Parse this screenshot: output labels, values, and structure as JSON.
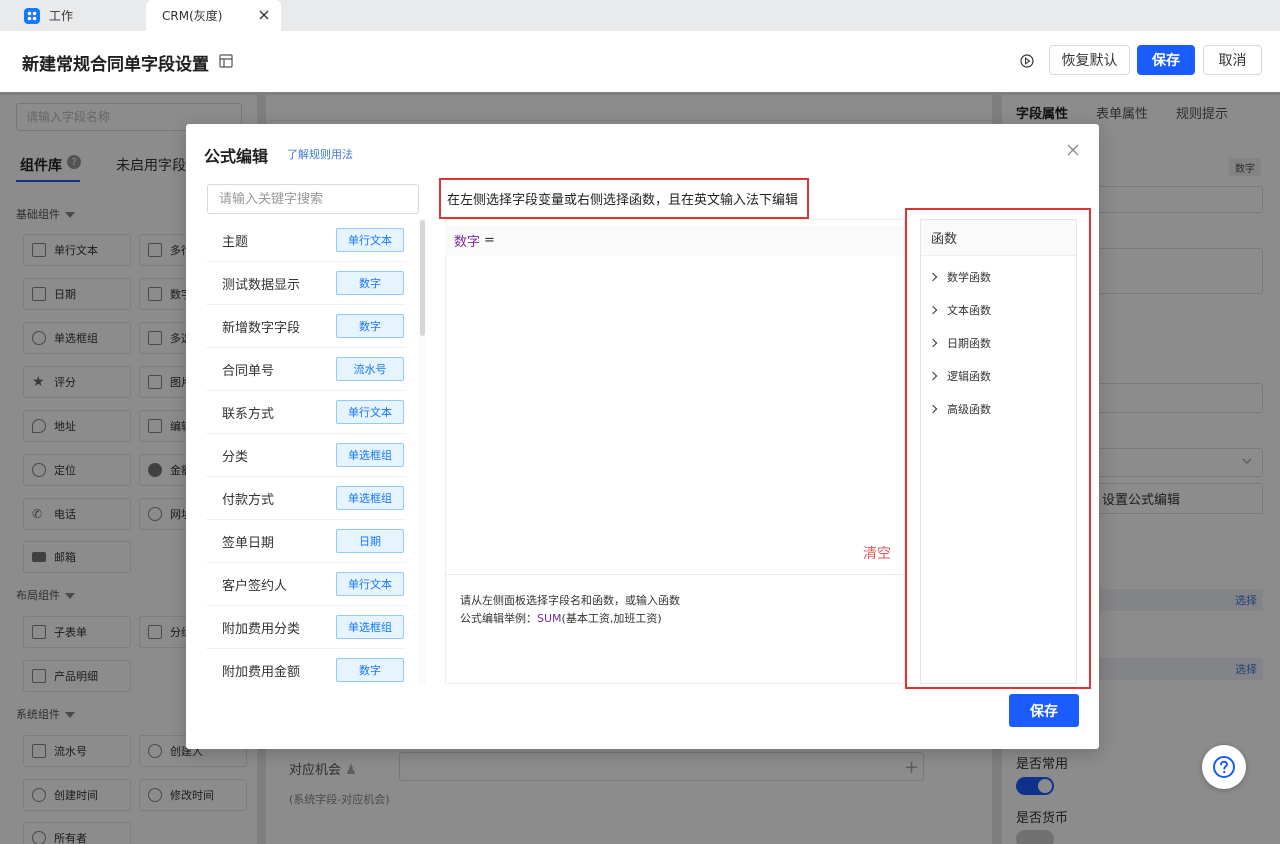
{
  "tabs": [
    {
      "label": "工作"
    },
    {
      "label": "CRM(灰度)"
    }
  ],
  "header": {
    "title": "新建常规合同单字段设置",
    "restore_label": "恢复默认",
    "save_label": "保存",
    "cancel_label": "取消"
  },
  "left": {
    "search_placeholder": "请输入字段名称",
    "tab_library": "组件库",
    "tab_unused": "未启用字段",
    "help_mark": "?",
    "sections": [
      {
        "title": "基础组件",
        "items": [
          "单行文本",
          "多行",
          "日期",
          "数字",
          "单选框组",
          "多选",
          "评分",
          "图片",
          "地址",
          "编辑",
          "定位",
          "金额",
          "电话",
          "网址",
          "邮箱"
        ]
      },
      {
        "title": "布局组件",
        "items": [
          "子表单",
          "分组",
          "产品明细"
        ]
      },
      {
        "title": "系统组件",
        "items": [
          "流水号",
          "创建人",
          "创建时间",
          "修改时间",
          "所有者"
        ]
      }
    ]
  },
  "center": {
    "opportunity_label": "对应机会",
    "opportunity_hint": "(系统字段-对应机会)"
  },
  "right": {
    "tab_field": "字段属性",
    "tab_form": "表单属性",
    "tab_rules": "规则提示",
    "type_badge": "数字",
    "set_formula_label": "设置公式编辑",
    "select_label_1": "选择",
    "select_label_2": "选择",
    "common_label": "是否常用",
    "currency_label": "是否货币",
    "common_on": true,
    "currency_on": false
  },
  "modal": {
    "title": "公式编辑",
    "help_link": "了解规则用法",
    "search_placeholder": "请输入关键字搜索",
    "hint": "在左侧选择字段变量或右侧选择函数，且在英文输入法下编辑",
    "fields": [
      {
        "name": "主题",
        "type": "单行文本"
      },
      {
        "name": "测试数据显示",
        "type": "数字"
      },
      {
        "name": "新增数字字段",
        "type": "数字"
      },
      {
        "name": "合同单号",
        "type": "流水号"
      },
      {
        "name": "联系方式",
        "type": "单行文本"
      },
      {
        "name": "分类",
        "type": "单选框组"
      },
      {
        "name": "付款方式",
        "type": "单选框组"
      },
      {
        "name": "签单日期",
        "type": "日期"
      },
      {
        "name": "客户签约人",
        "type": "单行文本"
      },
      {
        "name": "附加费用分类",
        "type": "单选框组"
      },
      {
        "name": "附加费用金额",
        "type": "数字"
      }
    ],
    "editor_var": "数字",
    "editor_eq": "=",
    "clear_label": "清空",
    "example_line1": "请从左侧面板选择字段名和函数，或输入函数",
    "example_prefix": "公式编辑举例：",
    "example_fn": "SUM",
    "example_args": "(基本工资,加班工资)",
    "functions_title": "函数",
    "function_categories": [
      "数学函数",
      "文本函数",
      "日期函数",
      "逻辑函数",
      "高级函数"
    ],
    "save_label": "保存"
  },
  "colors": {
    "primary": "#1a5cff",
    "tag_bg": "#e6f4ff",
    "tag_text": "#1677ff",
    "highlight_red": "#e03333",
    "formula_var": "#7a2b9c",
    "clear_red": "#e35b5b"
  }
}
